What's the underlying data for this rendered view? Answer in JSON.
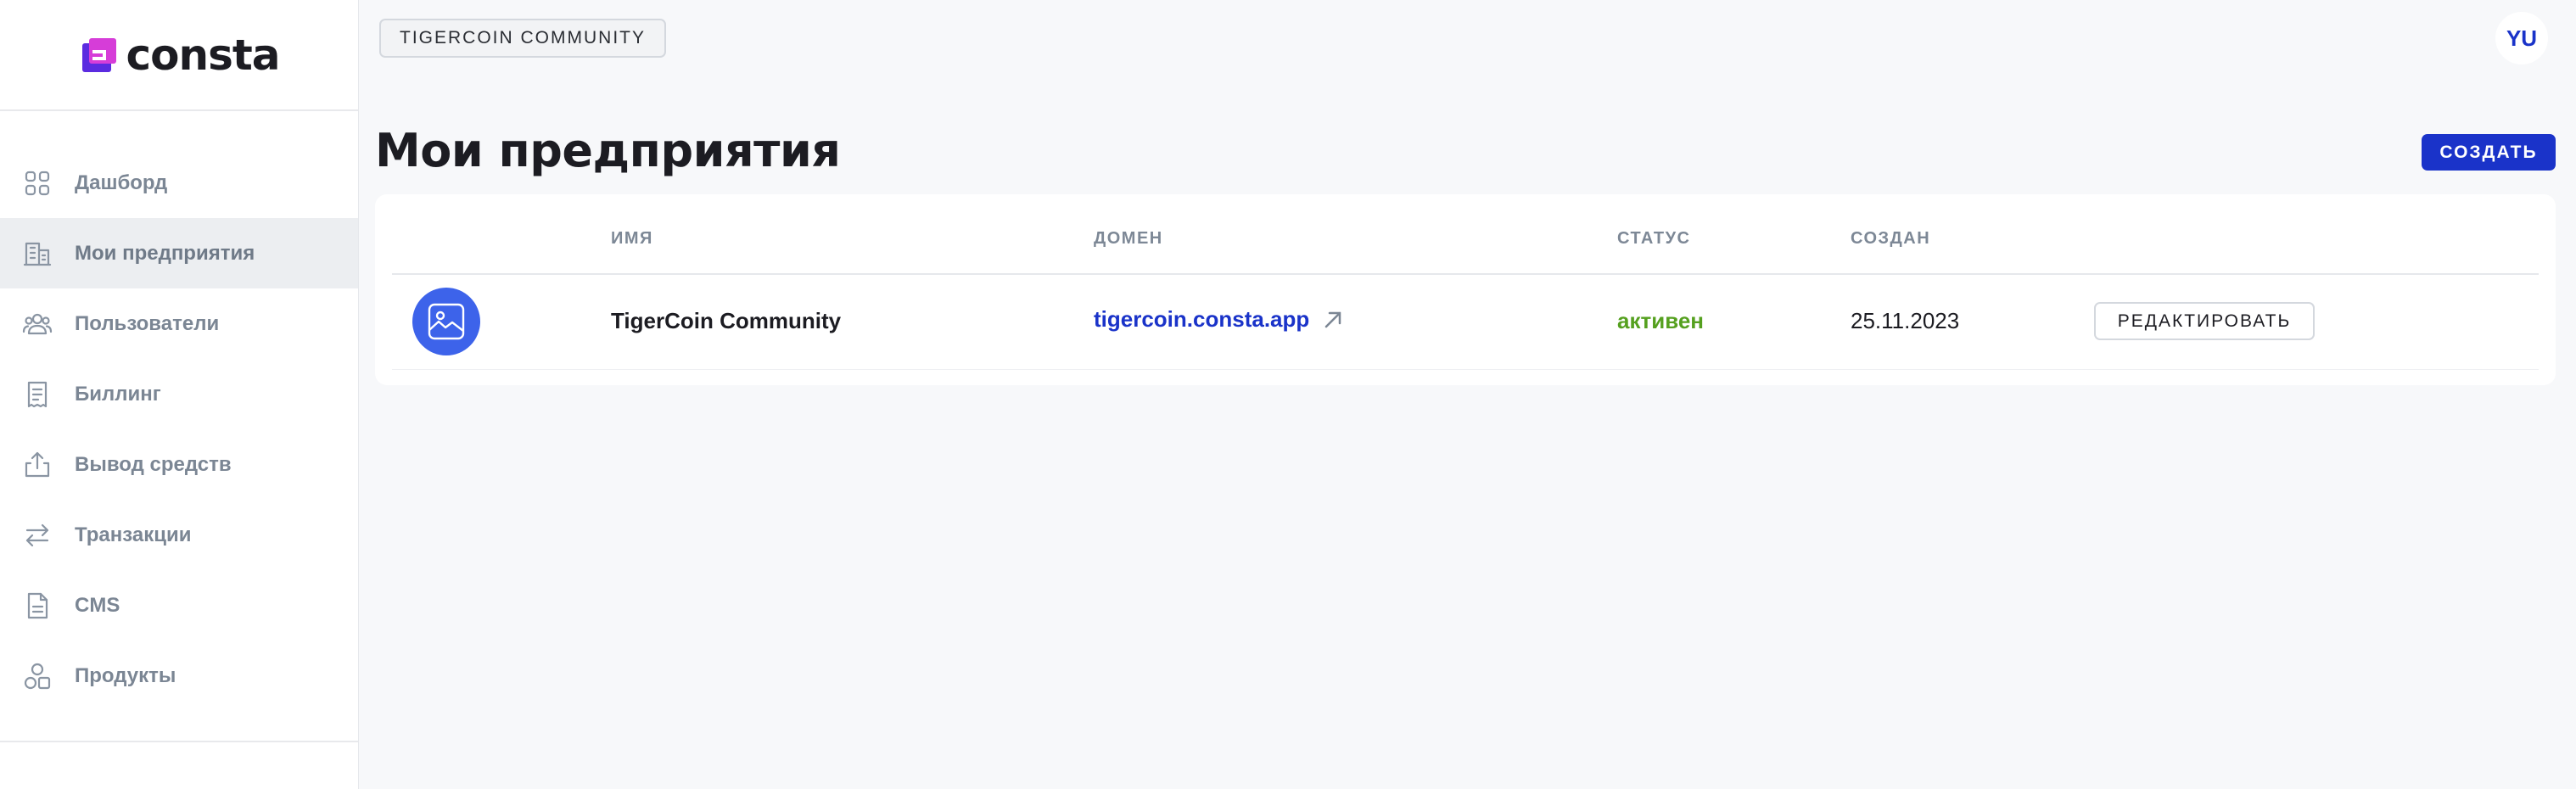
{
  "brand": {
    "name": "consta"
  },
  "sidebar": {
    "items": [
      {
        "label": "Дашборд",
        "icon": "dashboard-icon",
        "active": false
      },
      {
        "label": "Мои предприятия",
        "icon": "building-icon",
        "active": true
      },
      {
        "label": "Пользователи",
        "icon": "users-icon",
        "active": false
      },
      {
        "label": "Биллинг",
        "icon": "receipt-icon",
        "active": false
      },
      {
        "label": "Вывод средств",
        "icon": "withdraw-icon",
        "active": false
      },
      {
        "label": "Транзакции",
        "icon": "transactions-icon",
        "active": false
      },
      {
        "label": "CMS",
        "icon": "document-icon",
        "active": false
      },
      {
        "label": "Продукты",
        "icon": "shapes-icon",
        "active": false
      }
    ]
  },
  "header": {
    "org_chip": "TIGERCOIN COMMUNITY",
    "avatar_initials": "YU"
  },
  "page": {
    "title": "Мои предприятия",
    "create_label": "СОЗДАТЬ"
  },
  "table": {
    "columns": [
      "ИМЯ",
      "ДОМЕН",
      "СТАТУС",
      "СОЗДАН"
    ],
    "rows": [
      {
        "name": "TigerCoin Community",
        "domain": "tigercoin.consta.app",
        "status": "активен",
        "created": "25.11.2023",
        "action": "РЕДАКТИРОВАТЬ"
      }
    ]
  },
  "colors": {
    "accent": "#1a33c9",
    "status_active": "#55a01f",
    "avatar_bg": "#3d63ea"
  }
}
